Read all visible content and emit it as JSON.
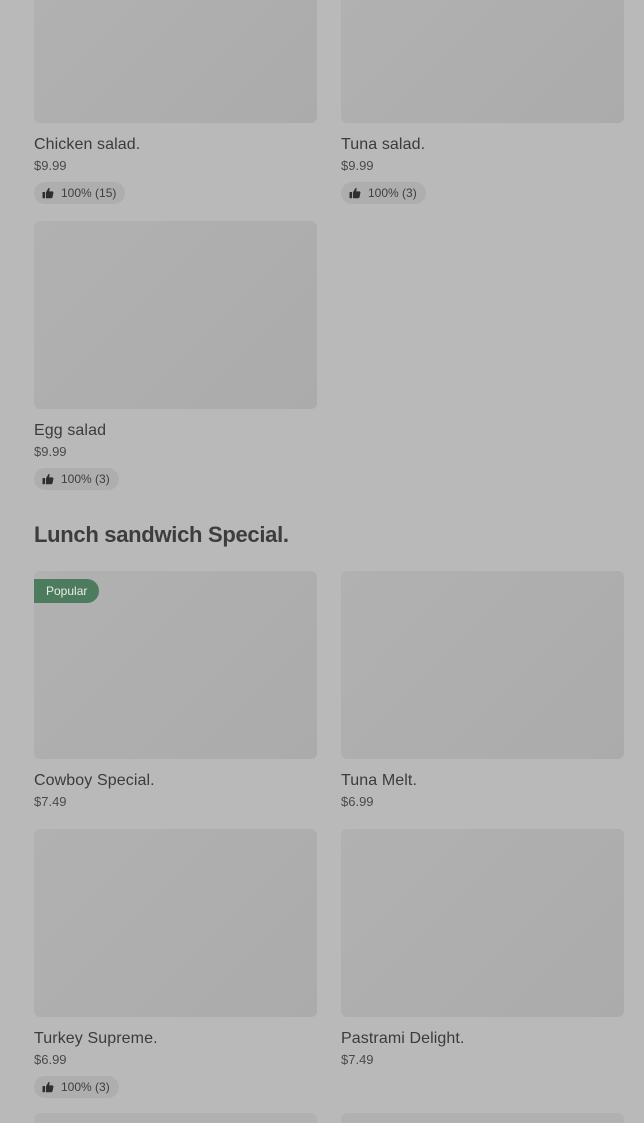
{
  "colors": {
    "overlay_background": "#b9b9b9",
    "thumbnail": "#afafaf",
    "badge_background": "#4d7b5d",
    "text": "#3b3b3b"
  },
  "items_top": [
    {
      "name": "Chicken salad.",
      "price": "$9.99",
      "rating": "100% (15)"
    },
    {
      "name": "Tuna salad.",
      "price": "$9.99",
      "rating": "100% (3)"
    },
    {
      "name": "Egg salad",
      "price": "$9.99",
      "rating": "100% (3)"
    }
  ],
  "section": {
    "title": "Lunch sandwich Special."
  },
  "items_lunch": [
    {
      "name": "Cowboy Special.",
      "price": "$7.49",
      "badge": "Popular"
    },
    {
      "name": "Tuna Melt.",
      "price": "$6.99"
    },
    {
      "name": "Turkey Supreme.",
      "price": "$6.99",
      "rating": "100% (3)"
    },
    {
      "name": "Pastrami Delight.",
      "price": "$7.49"
    }
  ],
  "icons": {
    "rating": "thumbs-up-icon"
  }
}
